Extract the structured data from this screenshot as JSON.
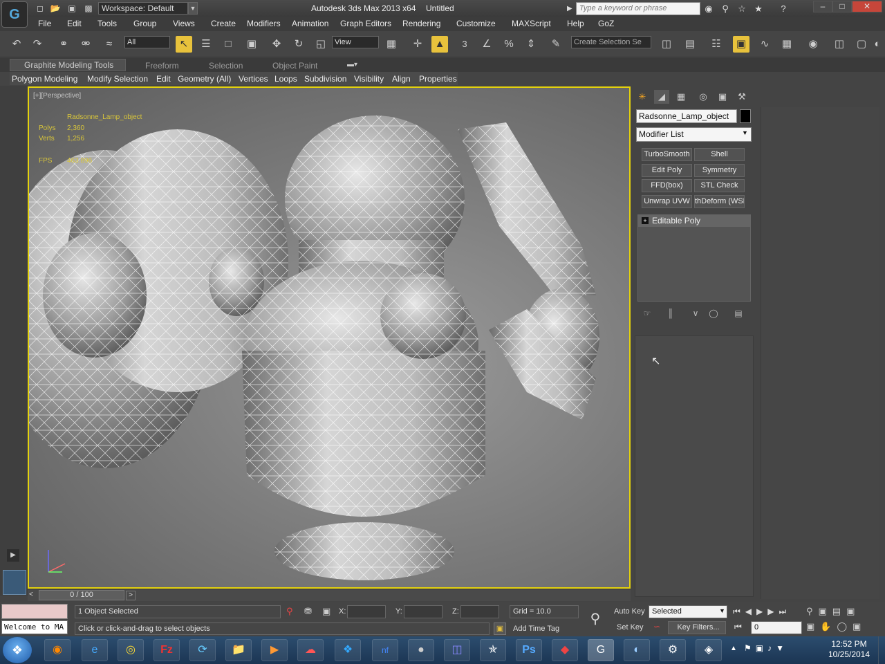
{
  "window": {
    "app_title": "Autodesk 3ds Max  2013 x64",
    "file_title": "Untitled",
    "workspace": "Workspace: Default",
    "search_placeholder": "Type a keyword or phrase"
  },
  "menu": [
    "File",
    "Edit",
    "Tools",
    "Group",
    "Views",
    "Create",
    "Modifiers",
    "Animation",
    "Graph Editors",
    "Rendering",
    "Customize",
    "MAXScript",
    "Help",
    "GoZ"
  ],
  "toolbar": {
    "selection_filter": "All",
    "ref_coord": "View",
    "named_selection": "Create Selection Se",
    "snap_number": "3"
  },
  "ribbon": {
    "tabs": [
      "Graphite Modeling Tools",
      "Freeform",
      "Selection",
      "Object Paint"
    ],
    "panels": [
      "Polygon Modeling",
      "Modify Selection",
      "Edit",
      "Geometry (All)",
      "Vertices",
      "Loops",
      "Subdivision",
      "Visibility",
      "Align",
      "Properties"
    ]
  },
  "viewport": {
    "label": "[+][Perspective]",
    "stats_object": "Radsonne_Lamp_object",
    "polys_label": "Polys",
    "polys_value": "2,360",
    "verts_label": "Verts",
    "verts_value": "1,256",
    "fps_label": "FPS",
    "fps_value": "463.896"
  },
  "command_panel": {
    "object_name": "Radsonne_Lamp_object",
    "modifier_list": "Modifier List",
    "modifier_buttons": [
      "TurboSmooth",
      "Shell",
      "Edit Poly",
      "Symmetry",
      "FFD(box)",
      "STL Check",
      "Unwrap UVW",
      "thDeform (WSM"
    ],
    "stack_item": "Editable Poly"
  },
  "timeline": {
    "frame": "0 / 100"
  },
  "status": {
    "maxscript": "Welcome to MA",
    "selected": "1 Object Selected",
    "prompt": "Click or click-and-drag to select objects",
    "x_label": "X:",
    "y_label": "Y:",
    "z_label": "Z:",
    "grid": "Grid = 10.0",
    "add_time_tag": "Add Time Tag",
    "auto_key": "Auto Key",
    "set_key": "Set Key",
    "key_mode": "Selected",
    "key_filters": "Key Filters...",
    "current_frame": "0"
  },
  "taskbar": {
    "time": "12:52 PM",
    "date": "10/25/2014"
  },
  "colors": {
    "viewport_border": "#e4d20c",
    "active_tool": "#e8c23c",
    "close_button": "#c7463a"
  }
}
